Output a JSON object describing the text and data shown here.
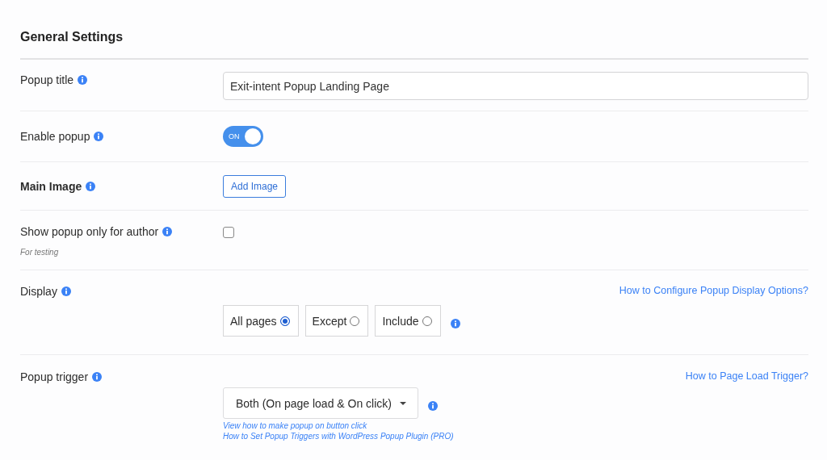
{
  "section_title": "General Settings",
  "rows": [
    {
      "kind": "text",
      "label": "Popup title",
      "bold": false,
      "value": "Exit-intent Popup Landing Page"
    },
    {
      "kind": "toggle",
      "label": "Enable popup",
      "bold": false,
      "on": true,
      "toggle_text": "ON"
    },
    {
      "kind": "button",
      "label": "Main Image",
      "bold": true,
      "button": "Add Image"
    },
    {
      "kind": "checkbox",
      "label": "Show popup only for author",
      "bold": false,
      "checked": false,
      "note": "For testing"
    },
    {
      "kind": "radio",
      "label": "Display",
      "bold": false,
      "help_link": "How to Configure Popup Display Options?",
      "options": [
        {
          "label": "All pages",
          "selected": true
        },
        {
          "label": "Except",
          "selected": false
        },
        {
          "label": "Include",
          "selected": false
        }
      ]
    },
    {
      "kind": "select",
      "label": "Popup trigger",
      "bold": false,
      "help_link": "How to Page Load Trigger?",
      "value": "Both (On page load & On click)",
      "links": [
        "View how to make popup on button click",
        "How to Set Popup Triggers with WordPress Popup Plugin (PRO)"
      ]
    }
  ]
}
